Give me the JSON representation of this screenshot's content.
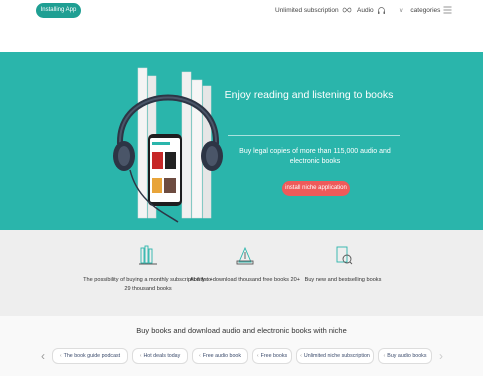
{
  "header": {
    "install_label": "Installing App",
    "subscription_label": "Unlimited subscription",
    "audio_label": "Audio",
    "categories_label": "categories",
    "categories_chevron": "∨"
  },
  "hero": {
    "title": "Enjoy reading and listening to books",
    "subtitle": "Buy legal copies of more than 115,000 audio and electronic books",
    "cta_label": "install niche application"
  },
  "features": [
    {
      "text": "The possibility of buying a monthly subscription for + 29 thousand books",
      "icon": "books-icon"
    },
    {
      "text": "Ability to download thousand free books 20+",
      "icon": "download-book-icon"
    },
    {
      "text": "Buy new and bestselling books",
      "icon": "bestseller-book-icon"
    }
  ],
  "bottom": {
    "title": "Buy books and download audio and electronic books with niche",
    "tags": [
      {
        "label": "The book guide podcast"
      },
      {
        "label": "Hot deals today"
      },
      {
        "label": "Free audio book"
      },
      {
        "label": "Free books"
      },
      {
        "label": "Unlimited niche subscription"
      },
      {
        "label": "Buy audio books"
      }
    ]
  },
  "colors": {
    "brand": "#1f9f93",
    "hero_bg": "#2ab5ab",
    "cta": "#ee5a5a"
  }
}
